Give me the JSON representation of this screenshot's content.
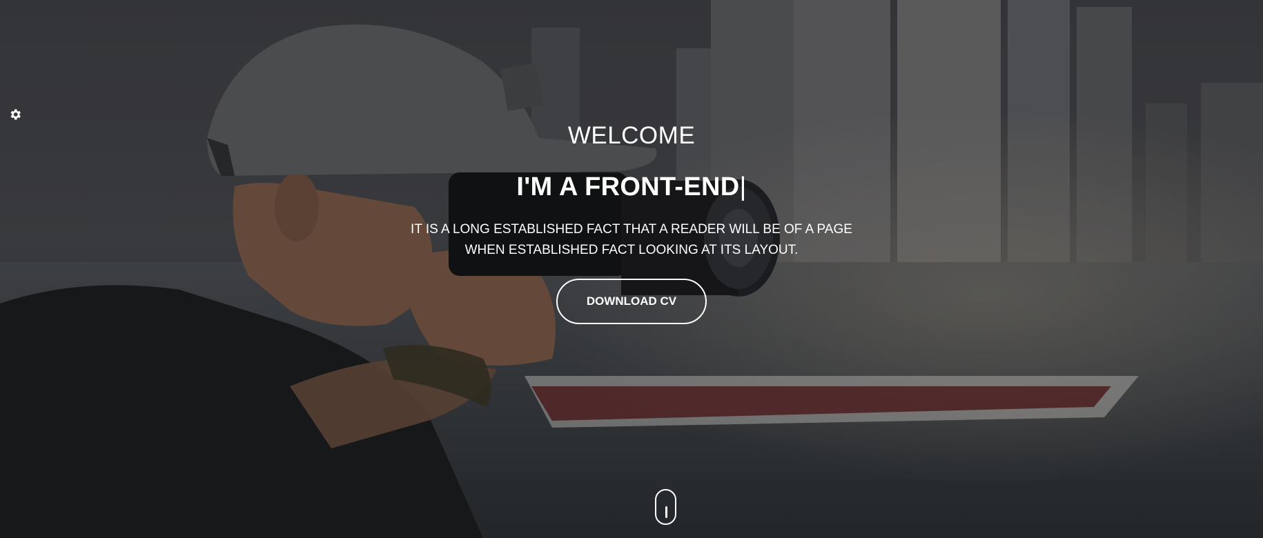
{
  "hero": {
    "welcome": "WELCOME",
    "headline": "I'M A FRONT-END",
    "cursor": "|",
    "description": "IT IS A LONG ESTABLISHED FACT THAT A READER WILL BE OF A PAGE WHEN ESTABLISHED FACT LOOKING AT ITS LAYOUT.",
    "cta_label": "DOWNLOAD CV"
  },
  "icons": {
    "settings": "gear-icon",
    "scroll": "mouse-scroll-icon"
  },
  "colors": {
    "text": "#ffffff",
    "background": "#303236"
  }
}
